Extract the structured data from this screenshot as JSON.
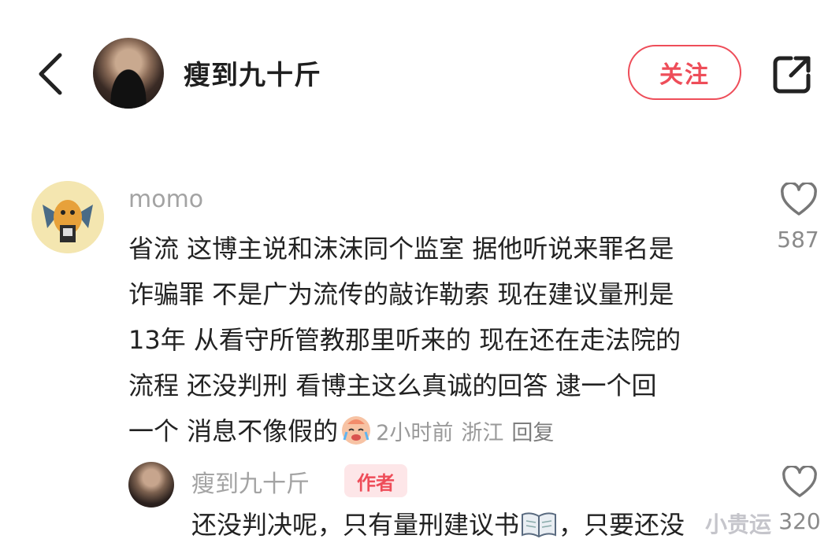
{
  "header": {
    "author_name": "瘦到九十斤",
    "follow_label": "关注",
    "icons": [
      "back-icon",
      "share-icon"
    ]
  },
  "comment": {
    "username": "momo",
    "lines": [
      "省流 这博主说和沫沫同个监室 据他听说来罪名是",
      "诈骗罪 不是广为流传的敲诈勒索 现在建议量刑是",
      "13年 从看守所管教那里听来的 现在还在走法院的",
      "流程 还没判刑 看博主这么真诚的回答 逮一个回",
      "一个 消息不像假的"
    ],
    "time": "2小时前",
    "location": "浙江",
    "reply_label": "回复",
    "like_count": "587"
  },
  "reply": {
    "username": "瘦到九十斤",
    "badge": "作者",
    "text_before_emoji": "还没判决呢，只有量刑建议书",
    "text_after_emoji": "，只要还没",
    "like_count": "320"
  },
  "watermark": "小贵运",
  "colors": {
    "accent": "#ee4d59",
    "muted_text": "#a3a3a3",
    "badge_bg": "#fde6e8"
  }
}
